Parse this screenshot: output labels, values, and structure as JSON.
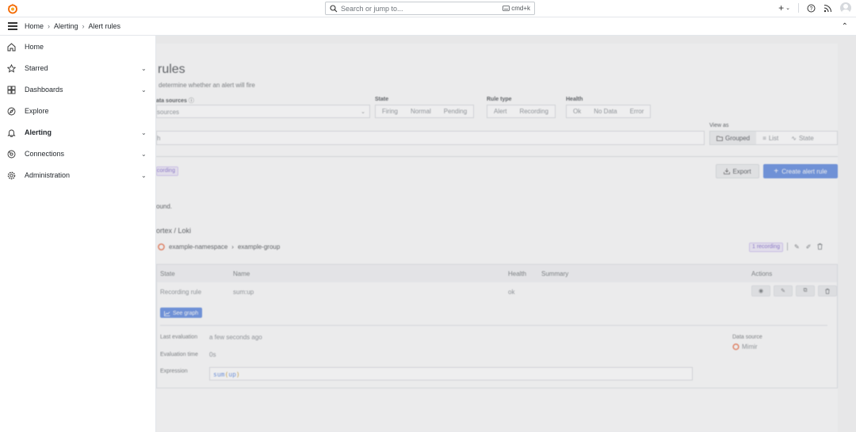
{
  "search": {
    "placeholder": "Search or jump to...",
    "shortcut": "cmd+k"
  },
  "topbar": {
    "plus": "+"
  },
  "breadcrumb": {
    "items": [
      "Home",
      "Alerting",
      "Alert rules"
    ]
  },
  "sidebar": {
    "items": [
      {
        "label": "Home",
        "icon": "home-icon"
      },
      {
        "label": "Starred",
        "icon": "star-icon"
      },
      {
        "label": "Dashboards",
        "icon": "dashboards-icon"
      },
      {
        "label": "Explore",
        "icon": "compass-icon"
      },
      {
        "label": "Alerting",
        "icon": "bell-icon"
      },
      {
        "label": "Connections",
        "icon": "connections-icon"
      },
      {
        "label": "Administration",
        "icon": "gear-icon"
      }
    ]
  },
  "page": {
    "title": "rules",
    "subtitle": "determine whether an alert will fire",
    "filters": {
      "data_sources_label": "ata sources",
      "data_sources_value": "sources",
      "state_label": "State",
      "state_options": [
        "Firing",
        "Normal",
        "Pending"
      ],
      "rule_type_label": "Rule type",
      "rule_type_options": [
        "Alert",
        "Recording"
      ],
      "health_label": "Health",
      "health_options": [
        "Ok",
        "No Data",
        "Error"
      ],
      "search_value": "h"
    },
    "view_as": {
      "label": "View as",
      "options": [
        "Grouped",
        "List",
        "State"
      ]
    },
    "chip": "cording",
    "export_label": "Export",
    "create_label": "Create alert rule",
    "no_found": "ound.",
    "section_title": "ortex / Loki",
    "group": {
      "namespace": "example-namespace",
      "separator": "›",
      "group": "example-group",
      "badge": "1 recording"
    },
    "table": {
      "headers": [
        "State",
        "Name",
        "Health",
        "Summary",
        "Actions"
      ],
      "row": {
        "state": "Recording rule",
        "name": "sum:up",
        "health": "ok",
        "summary": ""
      },
      "see_graph": "See graph",
      "details": {
        "last_eval_label": "Last evaluation",
        "last_eval_value": "a few seconds ago",
        "eval_time_label": "Evaluation time",
        "eval_time_value": "0s",
        "expression_label": "Expression",
        "expr_fn": "sum",
        "expr_open": "(",
        "expr_arg": "up",
        "expr_close": ")",
        "data_source_label": "Data source",
        "data_source_value": "Mimir"
      }
    }
  },
  "colors": {
    "primary": "#3d71d9",
    "badge_bg": "#ebe5f8",
    "badge_text": "#6a4fc0",
    "grafana_orange": "#f46800"
  }
}
